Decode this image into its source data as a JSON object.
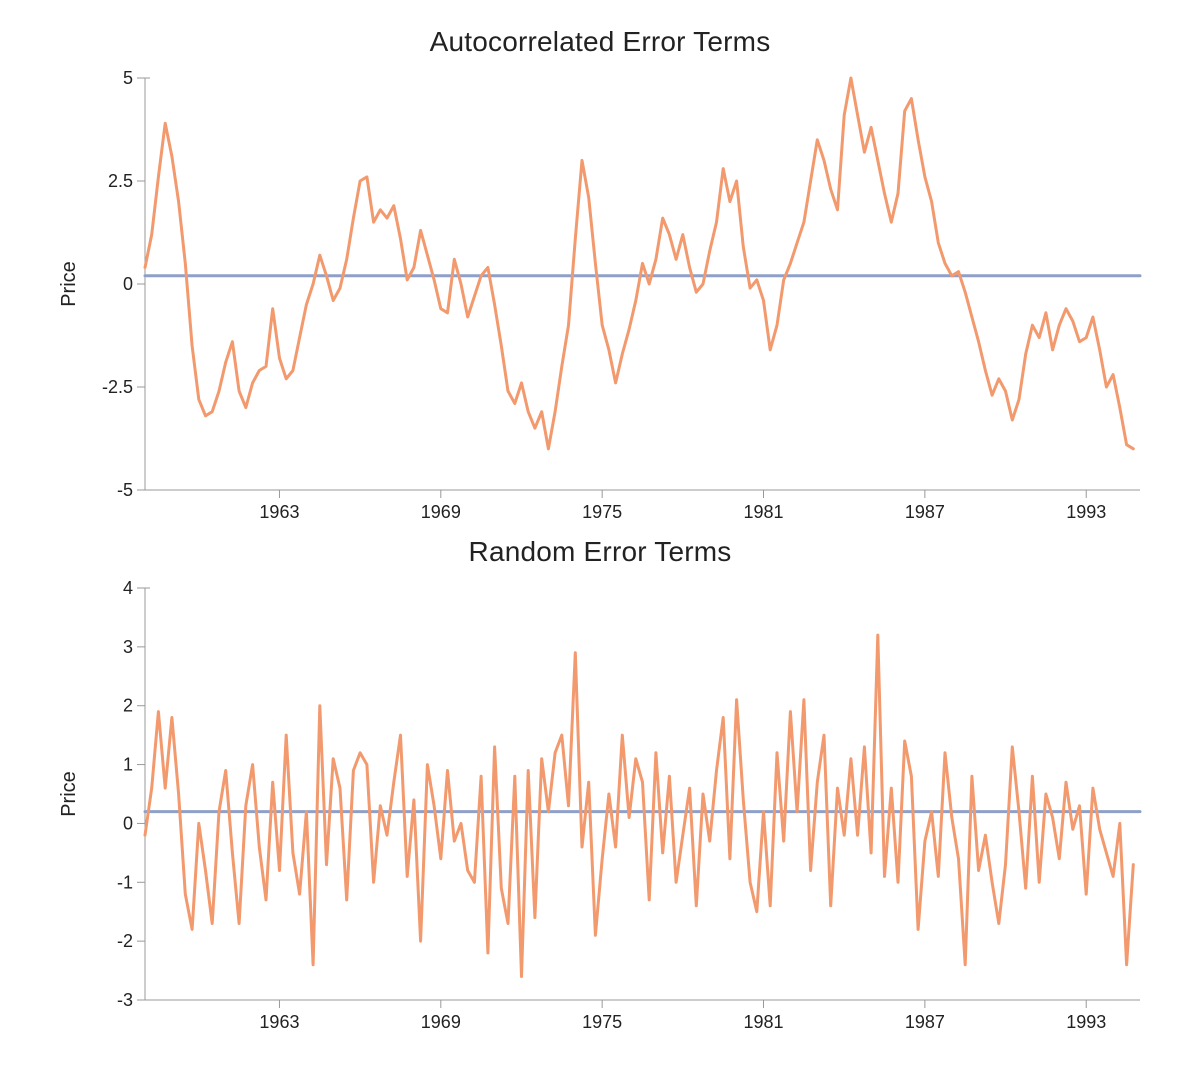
{
  "chart_data": [
    {
      "type": "line",
      "title": "Autocorrelated Error Terms",
      "ylabel": "Price",
      "xlabel": "",
      "x_range": [
        1958,
        1995
      ],
      "ylim": [
        -5,
        5
      ],
      "y_ticks": [
        -5,
        -2.5,
        0,
        2.5,
        5
      ],
      "x_ticks": [
        1963,
        1969,
        1975,
        1981,
        1987,
        1993
      ],
      "reference_y": 0.2,
      "series": [
        {
          "name": "autocorrelated_errors",
          "x_start": 1958,
          "x_step": 0.25,
          "values": [
            0.4,
            1.2,
            2.6,
            3.9,
            3.1,
            2.0,
            0.5,
            -1.5,
            -2.8,
            -3.2,
            -3.1,
            -2.6,
            -1.9,
            -1.4,
            -2.6,
            -3.0,
            -2.4,
            -2.1,
            -2.0,
            -0.6,
            -1.8,
            -2.3,
            -2.1,
            -1.3,
            -0.5,
            0.0,
            0.7,
            0.2,
            -0.4,
            -0.1,
            0.6,
            1.6,
            2.5,
            2.6,
            1.5,
            1.8,
            1.6,
            1.9,
            1.1,
            0.1,
            0.4,
            1.3,
            0.7,
            0.1,
            -0.6,
            -0.7,
            0.6,
            0.0,
            -0.8,
            -0.3,
            0.2,
            0.4,
            -0.5,
            -1.5,
            -2.6,
            -2.9,
            -2.4,
            -3.1,
            -3.5,
            -3.1,
            -4.0,
            -3.1,
            -2.0,
            -1.0,
            1.1,
            3.0,
            2.1,
            0.5,
            -1.0,
            -1.6,
            -2.4,
            -1.7,
            -1.1,
            -0.4,
            0.5,
            0.0,
            0.6,
            1.6,
            1.2,
            0.6,
            1.2,
            0.4,
            -0.2,
            0.0,
            0.8,
            1.5,
            2.8,
            2.0,
            2.5,
            0.9,
            -0.1,
            0.1,
            -0.4,
            -1.6,
            -1.0,
            0.1,
            0.5,
            1.0,
            1.5,
            2.5,
            3.5,
            3.0,
            2.3,
            1.8,
            4.1,
            5.0,
            4.1,
            3.2,
            3.8,
            3.0,
            2.2,
            1.5,
            2.2,
            4.2,
            4.5,
            3.5,
            2.6,
            2.0,
            1.0,
            0.5,
            0.2,
            0.3,
            -0.2,
            -0.8,
            -1.4,
            -2.1,
            -2.7,
            -2.3,
            -2.6,
            -3.3,
            -2.8,
            -1.7,
            -1.0,
            -1.3,
            -0.7,
            -1.6,
            -1.0,
            -0.6,
            -0.9,
            -1.4,
            -1.3,
            -0.8,
            -1.6,
            -2.5,
            -2.2,
            -3.0,
            -3.9,
            -4.0
          ]
        }
      ]
    },
    {
      "type": "line",
      "title": "Random Error Terms",
      "ylabel": "Price",
      "xlabel": "",
      "x_range": [
        1958,
        1995
      ],
      "ylim": [
        -3,
        4
      ],
      "y_ticks": [
        -3,
        -2,
        -1,
        0,
        1,
        2,
        3,
        4
      ],
      "x_ticks": [
        1963,
        1969,
        1975,
        1981,
        1987,
        1993
      ],
      "reference_y": 0.2,
      "series": [
        {
          "name": "random_errors",
          "x_start": 1958,
          "x_step": 0.25,
          "values": [
            -0.2,
            0.6,
            1.9,
            0.6,
            1.8,
            0.5,
            -1.2,
            -1.8,
            0.0,
            -0.8,
            -1.7,
            0.2,
            0.9,
            -0.5,
            -1.7,
            0.3,
            1.0,
            -0.4,
            -1.3,
            0.7,
            -0.8,
            1.5,
            -0.5,
            -1.2,
            0.2,
            -2.4,
            2.0,
            -0.7,
            1.1,
            0.6,
            -1.3,
            0.9,
            1.2,
            1.0,
            -1.0,
            0.3,
            -0.2,
            0.7,
            1.5,
            -0.9,
            0.4,
            -2.0,
            1.0,
            0.3,
            -0.6,
            0.9,
            -0.3,
            0.0,
            -0.8,
            -1.0,
            0.8,
            -2.2,
            1.3,
            -1.1,
            -1.7,
            0.8,
            -2.6,
            0.9,
            -1.6,
            1.1,
            0.2,
            1.2,
            1.5,
            0.3,
            2.9,
            -0.4,
            0.7,
            -1.9,
            -0.6,
            0.5,
            -0.4,
            1.5,
            0.1,
            1.1,
            0.7,
            -1.3,
            1.2,
            -0.5,
            0.8,
            -1.0,
            -0.2,
            0.6,
            -1.4,
            0.5,
            -0.3,
            0.9,
            1.8,
            -0.6,
            2.1,
            0.4,
            -1.0,
            -1.5,
            0.2,
            -1.4,
            1.2,
            -0.3,
            1.9,
            0.2,
            2.1,
            -0.8,
            0.7,
            1.5,
            -1.4,
            0.6,
            -0.2,
            1.1,
            -0.2,
            1.3,
            -0.5,
            3.2,
            -0.9,
            0.6,
            -1.0,
            1.4,
            0.8,
            -1.8,
            -0.3,
            0.2,
            -0.9,
            1.2,
            0.1,
            -0.6,
            -2.4,
            0.8,
            -0.8,
            -0.2,
            -1.0,
            -1.7,
            -0.7,
            1.3,
            0.2,
            -1.1,
            0.8,
            -1.0,
            0.5,
            0.1,
            -0.6,
            0.7,
            -0.1,
            0.3,
            -1.2,
            0.6,
            -0.1,
            -0.5,
            -0.9,
            0.0,
            -2.4,
            -0.7
          ]
        }
      ]
    }
  ]
}
